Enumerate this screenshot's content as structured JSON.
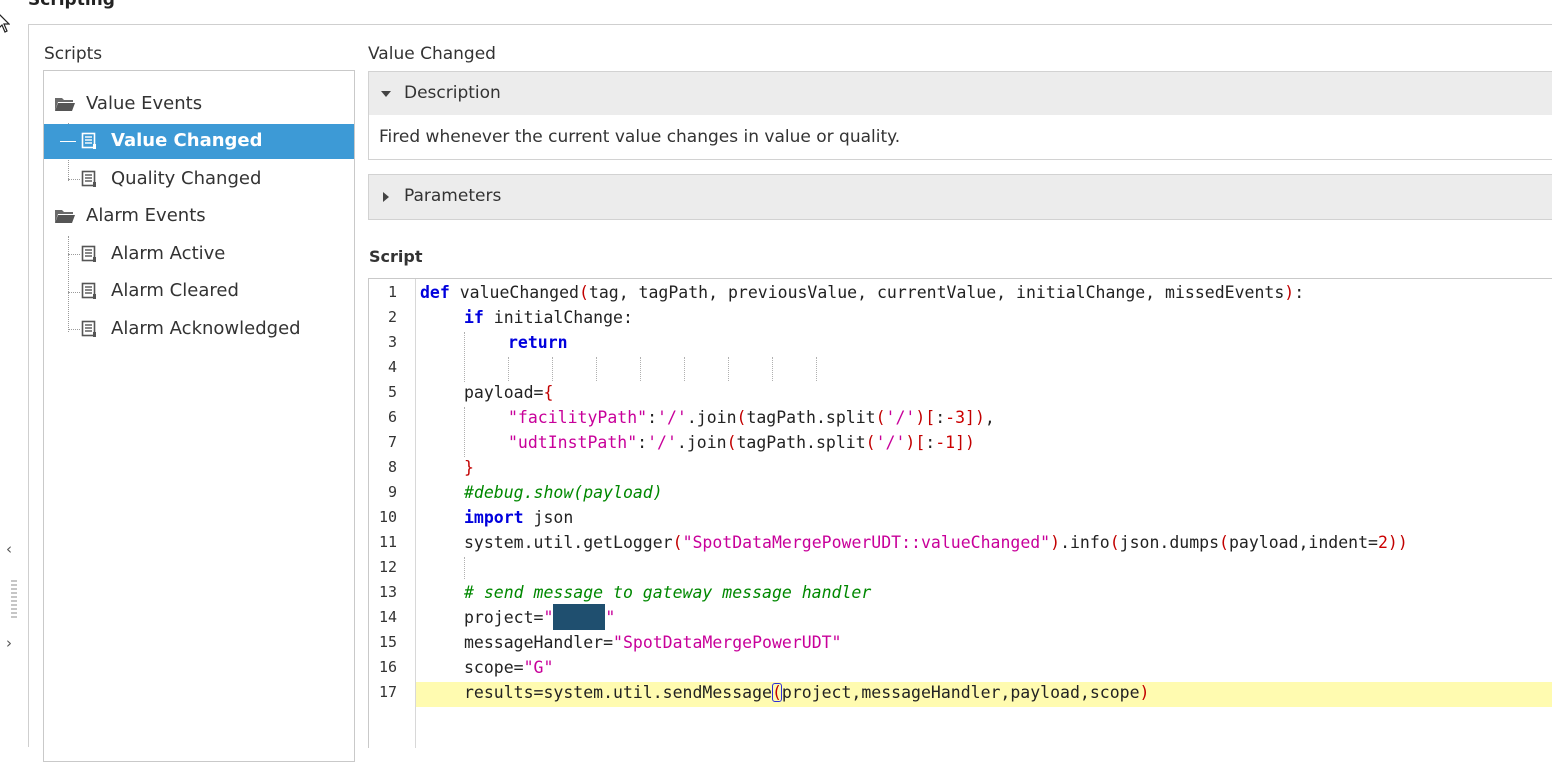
{
  "section_title": "Scripting",
  "scripts_panel": {
    "label": "Scripts",
    "groups": [
      {
        "label": "Value Events",
        "items": [
          "Value Changed",
          "Quality Changed"
        ]
      },
      {
        "label": "Alarm Events",
        "items": [
          "Alarm Active",
          "Alarm Cleared",
          "Alarm Acknowledged"
        ]
      }
    ],
    "selected": "Value Changed"
  },
  "detail": {
    "title": "Value Changed",
    "description_header": "Description",
    "description_text": "Fired whenever the current value changes in value or quality.",
    "parameters_header": "Parameters",
    "script_label": "Script"
  },
  "editor": {
    "line_numbers": [
      "1",
      "2",
      "3",
      "4",
      "5",
      "6",
      "7",
      "8",
      "9",
      "10",
      "11",
      "12",
      "13",
      "14",
      "15",
      "16",
      "17"
    ],
    "code": {
      "l1_kw": "def",
      "l1_rest": " valueChanged",
      "l1_args": "tag, tagPath, previousValue, currentValue, initialChange, missedEvents",
      "l2_kw": "if",
      "l2_rest": " initialChange:",
      "l3_kw": "return",
      "l5_lhs": "payload=",
      "l6_key": "\"facilityPath\"",
      "l6_sep": ":",
      "l6_str": "'/'",
      "l6_mid": ".join",
      "l6_arg": "tagPath.split",
      "l6_str2": "'/'",
      "l6_num": "-3",
      "l7_key": "\"udtInstPath\"",
      "l7_sep": ":",
      "l7_str": "'/'",
      "l7_mid": ".join",
      "l7_arg": "tagPath.split",
      "l7_str2": "'/'",
      "l7_num": "-1",
      "l9_cmt": "#debug.show(payload)",
      "l10_kw": "import",
      "l10_rest": " json",
      "l11_a": "system.util.getLogger",
      "l11_str": "\"SpotDataMergePowerUDT::valueChanged\"",
      "l11_b": ".info",
      "l11_c": "json.dumps",
      "l11_d": "payload,indent=",
      "l11_num": "2",
      "l13_cmt": "# send message to gateway message handler",
      "l14_lhs": "project=",
      "l15_lhs": "messageHandler=",
      "l15_str": "\"SpotDataMergePowerUDT\"",
      "l16_lhs": "scope=",
      "l16_str": "\"G\"",
      "l17_a": "results=system.util.sendMessage",
      "l17_args": "project,messageHandler,payload,scope"
    }
  },
  "icons": {
    "folder": "folder-open-icon",
    "script": "script-document-icon",
    "collapse": "collapse-left-icon",
    "expand": "expand-right-icon"
  },
  "colors": {
    "selection": "#3d9ad6",
    "keyword": "#0000dd",
    "string": "#c8009a",
    "number": "#cc0000",
    "comment": "#008800",
    "current_line": "#fffbb0"
  }
}
